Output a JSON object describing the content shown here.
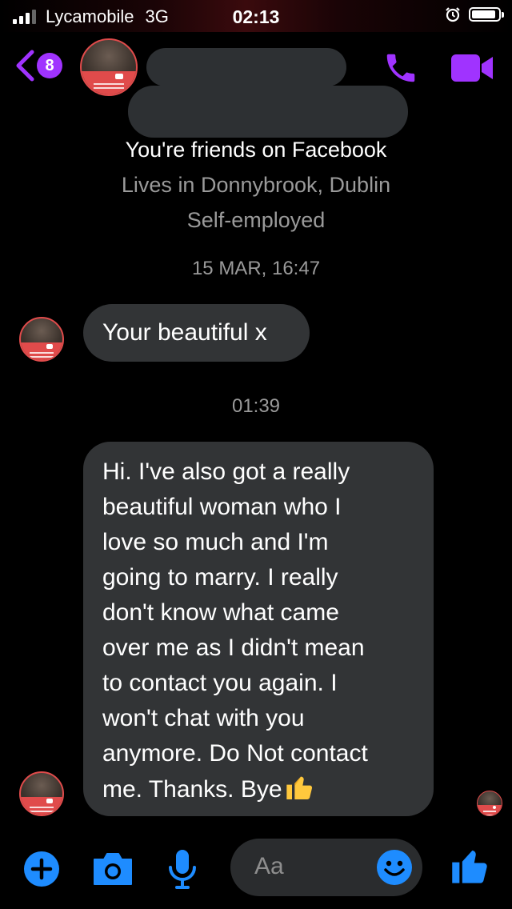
{
  "status_bar": {
    "carrier": "Lycamobile",
    "network": "3G",
    "time": "02:13",
    "battery_level": 0.9
  },
  "header": {
    "unread_count": "8",
    "icons": [
      "back-chevron-icon",
      "phone-icon",
      "video-camera-icon"
    ]
  },
  "contact_info": {
    "friends": "You're friends on Facebook",
    "lives": "Lives in Donnybrook, Dublin",
    "work": "Self-employed"
  },
  "messages": [
    {
      "timestamp": "15 MAR, 16:47",
      "text": "Your beautiful x"
    },
    {
      "timestamp": "01:39",
      "text": "Hi. I've also got a really\nbeautiful woman who I\nlove so much and I'm\ngoing to marry. I really\ndon't know what came\nover me as I didn't mean\nto contact you again. I\nwon't chat with you\nanymore. Do Not contact\nme. Thanks. Bye",
      "emoji": "thumbs-up"
    }
  ],
  "composer": {
    "placeholder": "Aa",
    "icons": [
      "plus-icon",
      "camera-icon",
      "microphone-icon",
      "emoji-icon",
      "thumbs-up-icon"
    ]
  },
  "colors": {
    "accent_purple": "#a033ff",
    "accent_blue": "#1e8cff",
    "bubble": "#323436",
    "avatar_red": "#e04b4b"
  }
}
